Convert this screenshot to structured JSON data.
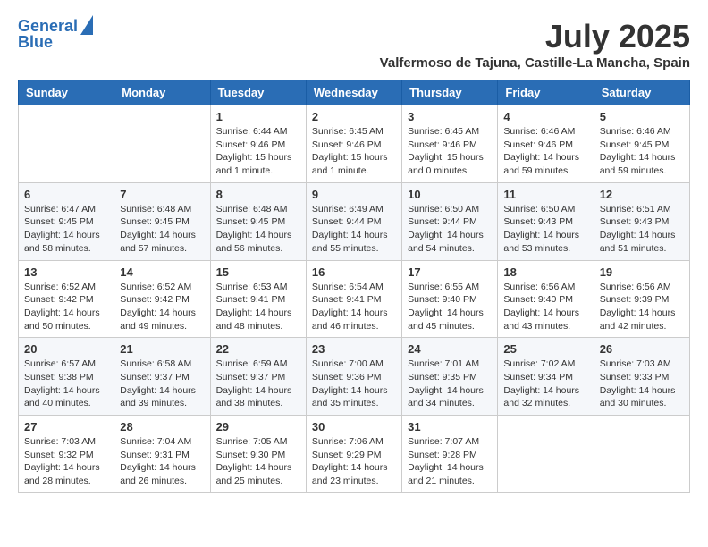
{
  "header": {
    "logo_line1": "General",
    "logo_line2": "Blue",
    "month_title": "July 2025",
    "location": "Valfermoso de Tajuna, Castille-La Mancha, Spain"
  },
  "weekdays": [
    "Sunday",
    "Monday",
    "Tuesday",
    "Wednesday",
    "Thursday",
    "Friday",
    "Saturday"
  ],
  "weeks": [
    [
      null,
      null,
      {
        "day": "1",
        "sunrise": "6:44 AM",
        "sunset": "9:46 PM",
        "daylight": "15 hours and 1 minute."
      },
      {
        "day": "2",
        "sunrise": "6:45 AM",
        "sunset": "9:46 PM",
        "daylight": "15 hours and 1 minute."
      },
      {
        "day": "3",
        "sunrise": "6:45 AM",
        "sunset": "9:46 PM",
        "daylight": "15 hours and 0 minutes."
      },
      {
        "day": "4",
        "sunrise": "6:46 AM",
        "sunset": "9:46 PM",
        "daylight": "14 hours and 59 minutes."
      },
      {
        "day": "5",
        "sunrise": "6:46 AM",
        "sunset": "9:45 PM",
        "daylight": "14 hours and 59 minutes."
      }
    ],
    [
      {
        "day": "6",
        "sunrise": "6:47 AM",
        "sunset": "9:45 PM",
        "daylight": "14 hours and 58 minutes."
      },
      {
        "day": "7",
        "sunrise": "6:48 AM",
        "sunset": "9:45 PM",
        "daylight": "14 hours and 57 minutes."
      },
      {
        "day": "8",
        "sunrise": "6:48 AM",
        "sunset": "9:45 PM",
        "daylight": "14 hours and 56 minutes."
      },
      {
        "day": "9",
        "sunrise": "6:49 AM",
        "sunset": "9:44 PM",
        "daylight": "14 hours and 55 minutes."
      },
      {
        "day": "10",
        "sunrise": "6:50 AM",
        "sunset": "9:44 PM",
        "daylight": "14 hours and 54 minutes."
      },
      {
        "day": "11",
        "sunrise": "6:50 AM",
        "sunset": "9:43 PM",
        "daylight": "14 hours and 53 minutes."
      },
      {
        "day": "12",
        "sunrise": "6:51 AM",
        "sunset": "9:43 PM",
        "daylight": "14 hours and 51 minutes."
      }
    ],
    [
      {
        "day": "13",
        "sunrise": "6:52 AM",
        "sunset": "9:42 PM",
        "daylight": "14 hours and 50 minutes."
      },
      {
        "day": "14",
        "sunrise": "6:52 AM",
        "sunset": "9:42 PM",
        "daylight": "14 hours and 49 minutes."
      },
      {
        "day": "15",
        "sunrise": "6:53 AM",
        "sunset": "9:41 PM",
        "daylight": "14 hours and 48 minutes."
      },
      {
        "day": "16",
        "sunrise": "6:54 AM",
        "sunset": "9:41 PM",
        "daylight": "14 hours and 46 minutes."
      },
      {
        "day": "17",
        "sunrise": "6:55 AM",
        "sunset": "9:40 PM",
        "daylight": "14 hours and 45 minutes."
      },
      {
        "day": "18",
        "sunrise": "6:56 AM",
        "sunset": "9:40 PM",
        "daylight": "14 hours and 43 minutes."
      },
      {
        "day": "19",
        "sunrise": "6:56 AM",
        "sunset": "9:39 PM",
        "daylight": "14 hours and 42 minutes."
      }
    ],
    [
      {
        "day": "20",
        "sunrise": "6:57 AM",
        "sunset": "9:38 PM",
        "daylight": "14 hours and 40 minutes."
      },
      {
        "day": "21",
        "sunrise": "6:58 AM",
        "sunset": "9:37 PM",
        "daylight": "14 hours and 39 minutes."
      },
      {
        "day": "22",
        "sunrise": "6:59 AM",
        "sunset": "9:37 PM",
        "daylight": "14 hours and 38 minutes."
      },
      {
        "day": "23",
        "sunrise": "7:00 AM",
        "sunset": "9:36 PM",
        "daylight": "14 hours and 35 minutes."
      },
      {
        "day": "24",
        "sunrise": "7:01 AM",
        "sunset": "9:35 PM",
        "daylight": "14 hours and 34 minutes."
      },
      {
        "day": "25",
        "sunrise": "7:02 AM",
        "sunset": "9:34 PM",
        "daylight": "14 hours and 32 minutes."
      },
      {
        "day": "26",
        "sunrise": "7:03 AM",
        "sunset": "9:33 PM",
        "daylight": "14 hours and 30 minutes."
      }
    ],
    [
      {
        "day": "27",
        "sunrise": "7:03 AM",
        "sunset": "9:32 PM",
        "daylight": "14 hours and 28 minutes."
      },
      {
        "day": "28",
        "sunrise": "7:04 AM",
        "sunset": "9:31 PM",
        "daylight": "14 hours and 26 minutes."
      },
      {
        "day": "29",
        "sunrise": "7:05 AM",
        "sunset": "9:30 PM",
        "daylight": "14 hours and 25 minutes."
      },
      {
        "day": "30",
        "sunrise": "7:06 AM",
        "sunset": "9:29 PM",
        "daylight": "14 hours and 23 minutes."
      },
      {
        "day": "31",
        "sunrise": "7:07 AM",
        "sunset": "9:28 PM",
        "daylight": "14 hours and 21 minutes."
      },
      null,
      null
    ]
  ],
  "labels": {
    "sunrise_prefix": "Sunrise: ",
    "sunset_prefix": "Sunset: ",
    "daylight_prefix": "Daylight: "
  }
}
